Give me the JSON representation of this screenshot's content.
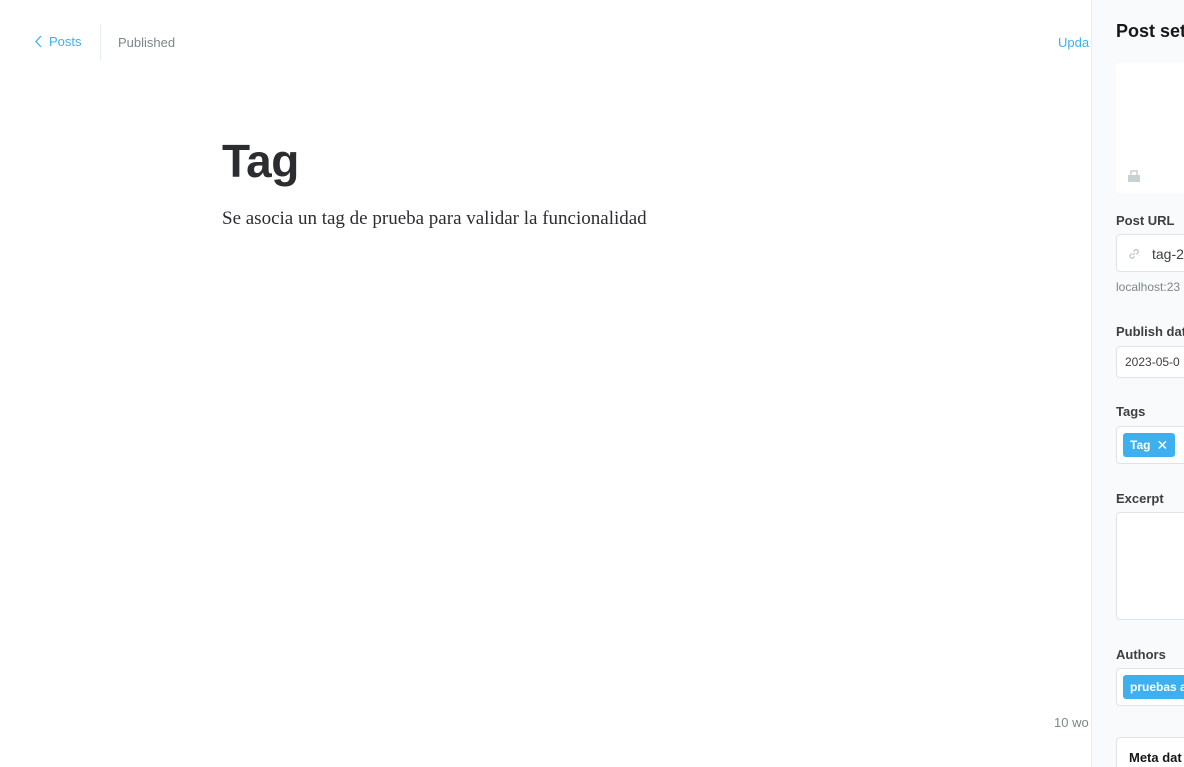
{
  "topbar": {
    "back_label": "Posts",
    "status": "Published",
    "update_label": "Upda"
  },
  "post": {
    "title": "Tag",
    "body": "Se asocia un tag de prueba para validar la funcionalidad",
    "word_count": "10 wo"
  },
  "settings": {
    "title": "Post sett",
    "post_url_label": "Post URL",
    "post_url_value": "tag-2",
    "post_url_hint": "localhost:23",
    "publish_date_label": "Publish dat",
    "publish_date_value": "2023-05-0",
    "tags_label": "Tags",
    "tags": [
      "Tag"
    ],
    "excerpt_label": "Excerpt",
    "authors_label": "Authors",
    "authors": [
      "pruebas a"
    ],
    "meta_data_label": "Meta dat"
  },
  "colors": {
    "accent": "#3eb0ef",
    "muted": "#7d878a",
    "border": "#dde3e7"
  }
}
